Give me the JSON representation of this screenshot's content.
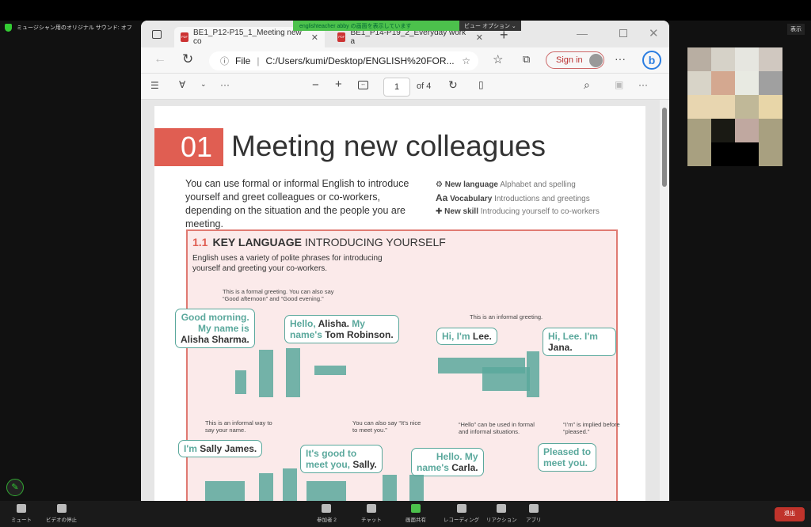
{
  "zoom": {
    "audio_status": "ミュージシャン用のオリジナル サウンド: オフ",
    "view_label": "表示",
    "share_banner": "englishteacher abby の画面を表示しています",
    "view_options": "ビュー オプション ⌄",
    "toolbar": [
      {
        "label": "ミュート",
        "icon": "microphone-icon"
      },
      {
        "label": "ビデオの停止",
        "icon": "video-camera-icon"
      },
      {
        "label": "参加者",
        "count": "2",
        "icon": "participants-icon"
      },
      {
        "label": "チャット",
        "icon": "chat-icon"
      },
      {
        "label": "画面共有",
        "icon": "share-screen-icon"
      },
      {
        "label": "レコーディング",
        "icon": "record-icon"
      },
      {
        "label": "リアクション",
        "icon": "reaction-icon"
      },
      {
        "label": "アプリ",
        "icon": "apps-icon"
      }
    ],
    "leave": "退出",
    "accent": "#4cc14c",
    "leave_color": "#c0332b",
    "thumbnail_colors": [
      "#b8aea2",
      "#d6d2c8",
      "#e6e6e0",
      "#d0c8c0",
      "#d8d4c8",
      "#d4a890",
      "#e8eae2",
      "#a0a0a0",
      "#e8d6b0",
      "#e8d6b0",
      "#c0b898",
      "#e8d6a8",
      "#a8a080",
      "#1a1a14",
      "#c0a8a0",
      "#a8a080",
      "#a8a080",
      "#000000",
      "#000000",
      "#a8a080"
    ]
  },
  "browser": {
    "tabs": [
      {
        "label": "BE1_P12-P15_1_Meeting new co"
      },
      {
        "label": "BE1_P14-P19_2_Everyday work a"
      }
    ],
    "file_label": "File",
    "url": "C:/Users/kumi/Desktop/ENGLISH%20FOR...",
    "sign_in": "Sign in"
  },
  "pdf": {
    "page": "1",
    "of": "of 4"
  },
  "doc": {
    "number": "01",
    "title": "Meeting new colleagues",
    "intro": "You can use formal or informal English to introduce yourself and greet colleagues or co-workers, depending on the situation and the people you are meeting.",
    "meta": [
      {
        "icon": "gears-icon",
        "k": "New language",
        "v": "Alphabet and spelling"
      },
      {
        "icon": "Aa",
        "k": "Vocabulary",
        "v": "Introductions and greetings"
      },
      {
        "icon": "puzzle-icon",
        "k": "New skill",
        "v": "Introducing yourself to co-workers"
      }
    ],
    "box": {
      "num": "1.1",
      "title_bold": "KEY LANGUAGE",
      "title_rest": "INTRODUCING YOURSELF",
      "text": "English uses a variety of polite phrases for introducing yourself and greeting your co-workers.",
      "captions": [
        "This is a formal greeting. You can also say “Good afternoon” and “Good evening.”",
        "This is an informal greeting.",
        "This is an informal way to say your name.",
        "You can also say “It’s nice to meet you.”",
        "“Hello” can be used in formal and informal situations.",
        "“I’m” is implied before “pleased.”"
      ],
      "bubbles": [
        [
          {
            "t": "Good morning."
          },
          {
            "t": "My name is"
          },
          {
            "t": "Alisha Sharma.",
            "d": 1
          }
        ],
        [
          {
            "t": "Hello, "
          },
          {
            "t": "Alisha.",
            "d": 1,
            "i": 1
          },
          {
            "t": " My",
            "i": 1
          },
          {
            "t": "name's "
          },
          {
            "t": "Tom Robinson.",
            "d": 1,
            "i": 1
          }
        ],
        [
          {
            "t": "Hi, I'm "
          },
          {
            "t": "Lee.",
            "d": 1,
            "i": 1
          }
        ],
        [
          {
            "t": "Hi, Lee. I'm "
          },
          {
            "t": "Jana.",
            "d": 1,
            "i": 1
          }
        ],
        [
          {
            "t": "I'm "
          },
          {
            "t": "Sally James.",
            "d": 1,
            "i": 1
          }
        ],
        [
          {
            "t": "It's good to"
          },
          {
            "t": "meet you, "
          },
          {
            "t": "Sally.",
            "d": 1,
            "i": 1
          }
        ],
        [
          {
            "t": "Hello. My"
          },
          {
            "t": "name's "
          },
          {
            "t": "Carla.",
            "d": 1,
            "i": 1
          }
        ],
        [
          {
            "t": "Pleased to"
          },
          {
            "t": "meet you."
          }
        ]
      ]
    }
  }
}
